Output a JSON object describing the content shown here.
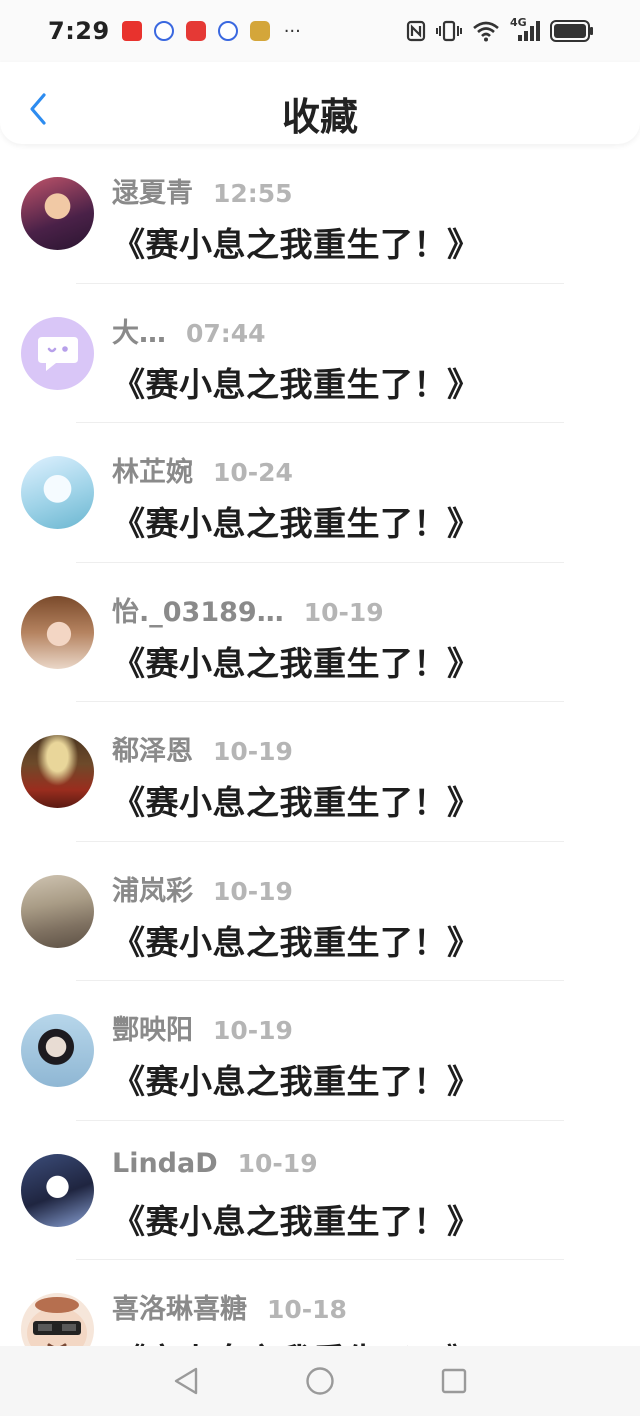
{
  "status_bar": {
    "time": "7:29",
    "more": "···",
    "network": "4G"
  },
  "header": {
    "title": "收藏",
    "accent_color": "#2d8cf0"
  },
  "items": [
    {
      "sender": "逯夏青",
      "time": "12:55",
      "message": "《赛小息之我重生了！》"
    },
    {
      "sender": "大…",
      "time": "07:44",
      "message": "《赛小息之我重生了！》"
    },
    {
      "sender": "林芷婉",
      "time": "10-24",
      "message": "《赛小息之我重生了！》"
    },
    {
      "sender": "怡._03189…",
      "time": "10-19",
      "message": "《赛小息之我重生了！》"
    },
    {
      "sender": "郗泽恩",
      "time": "10-19",
      "message": "《赛小息之我重生了！》"
    },
    {
      "sender": "浦岚彩",
      "time": "10-19",
      "message": "《赛小息之我重生了！》"
    },
    {
      "sender": "酆映阳",
      "time": "10-19",
      "message": "《赛小息之我重生了！》"
    },
    {
      "sender": "LindaD",
      "time": "10-19",
      "message": "《赛小息之我重生了！》"
    },
    {
      "sender": "喜洛琳喜糖",
      "time": "10-18",
      "message": "《赛小息之我重生了！》"
    }
  ]
}
